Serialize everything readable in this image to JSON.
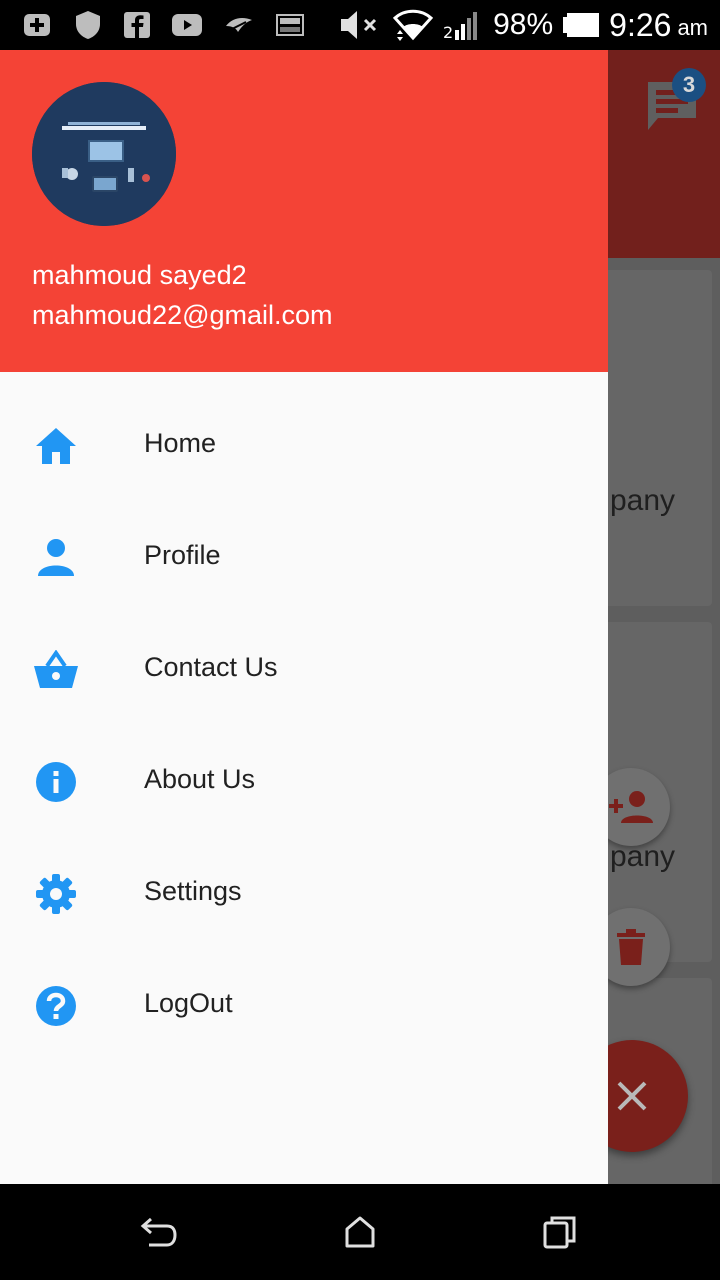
{
  "status_bar": {
    "left_icons": [
      "add-box-icon",
      "shield-icon",
      "facebook-icon",
      "youtube-icon",
      "bird-icon",
      "image-icon"
    ],
    "right_icons": [
      "mute-icon",
      "wifi-icon",
      "signal-icon",
      "battery-icon"
    ],
    "battery_percent": "98%",
    "time": "9:26",
    "ampm": "am"
  },
  "drawer": {
    "header": {
      "user_name": "mahmoud sayed2",
      "user_email": "mahmoud22@gmail.com"
    },
    "items": [
      {
        "label": "Home",
        "icon": "home-icon"
      },
      {
        "label": "Profile",
        "icon": "person-icon"
      },
      {
        "label": "Contact Us",
        "icon": "basket-icon"
      },
      {
        "label": "About Us",
        "icon": "info-icon"
      },
      {
        "label": "Settings",
        "icon": "gear-icon"
      },
      {
        "label": "LogOut",
        "icon": "help-icon"
      }
    ]
  },
  "background_app": {
    "notification_count": "3",
    "card_text_1": "pany",
    "card_text_2": "pany"
  },
  "colors": {
    "header": "#f44336",
    "icon": "#2196f3",
    "drawer_bg": "#fafafa"
  }
}
